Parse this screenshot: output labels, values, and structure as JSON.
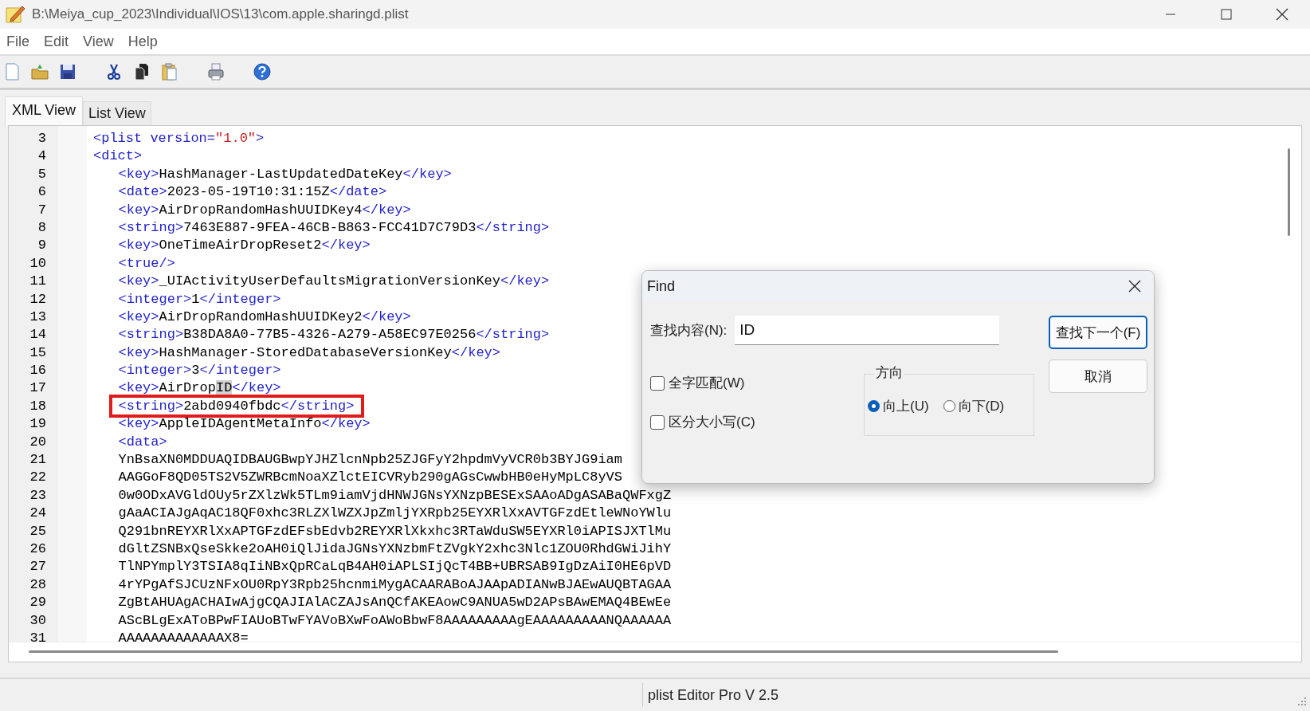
{
  "window": {
    "title": "B:\\Meiya_cup_2023\\Individual\\IOS\\13\\com.apple.sharingd.plist"
  },
  "menu": [
    "File",
    "Edit",
    "View",
    "Help"
  ],
  "toolbar": [
    {
      "kind": "new"
    },
    {
      "kind": "open"
    },
    {
      "kind": "save"
    },
    {
      "kind": "cut"
    },
    {
      "kind": "copy"
    },
    {
      "kind": "paste"
    },
    {
      "kind": "print"
    },
    {
      "kind": "help"
    }
  ],
  "tabs": [
    {
      "label": "XML View",
      "selected": true
    },
    {
      "label": "List View",
      "selected": false
    }
  ],
  "editor": {
    "lines": [
      {
        "number": "3",
        "text": "<plist version=\"1.0\">"
      },
      {
        "number": "4",
        "text": "<dict>",
        "children": [
          {
            "number": "5",
            "text": "<key>HashManager-LastUpdatedDateKey</key>"
          },
          {
            "number": "6",
            "text": "<date>2023-05-19T10:31:15Z</date>"
          },
          {
            "number": "7",
            "text": "<key>AirDropRandomHashUUIDKey4</key>"
          },
          {
            "number": "8",
            "text": "<string>7463E887-9FEA-46CB-B863-FCC41D7C79D3</string>"
          },
          {
            "number": "9",
            "text": "<key>OneTimeAirDropReset2</key>"
          },
          {
            "number": "10",
            "text": "<true/>"
          },
          {
            "number": "11",
            "text": "<key>_UIActivityUserDefaultsMigrationVersionKey</key>"
          },
          {
            "number": "12",
            "text": "<integer>1</integer>"
          },
          {
            "number": "13",
            "text": "<key>AirDropRandomHashUUIDKey2</key>"
          },
          {
            "number": "14",
            "text": "<string>B38DA8A0-77B5-4326-A279-A58EC97E0256</string>"
          },
          {
            "number": "15",
            "text": "<key>HashManager-StoredDatabaseVersionKey</key>"
          },
          {
            "number": "16",
            "text": "<integer>3</integer>"
          },
          {
            "number": "17",
            "text": "<key>AirDrop",
            "selection": "ID",
            "text_after": "</key>"
          },
          {
            "number": "18",
            "text": "<string>2abd0940fbdc</string>",
            "boxed": true
          },
          {
            "number": "19",
            "text": "<key>AppleIDAgentMetaInfo</key>"
          },
          {
            "number": "20",
            "text": "<data>"
          },
          {
            "number": "21",
            "text": "YnBsaXN0MDDUAQIDBAUGBwpYJHZlcnNpb25ZJGFyY2hpdmVyVCR0b3BYJG9iam"
          },
          {
            "number": "22",
            "text": "AAGGoF8QD05TS2V5ZWRBcmNoaXZlctEICVRyb290gAGsCwwbHB0eHyMpLC8yVS"
          },
          {
            "number": "23",
            "text": "0w0ODxAVGldOUy5rZXlzWk5TLm9iamVjdHNWJGNsYXNzpBESExSAAoADgASABaQWFxgZ"
          },
          {
            "number": "24",
            "text": "gAaACIAJgAqAC18QF0xhc3RLZXlWZXJpZmljYXRpb25EYXRlXxAVTGFzdEtleWNoYWlu"
          },
          {
            "number": "25",
            "text": "Q291bnREYXRlXxAPTGFzdEFsbEdvb2REYXRlXkxhc3RTaWduSW5EYXRl0iAPISJXTlMu"
          },
          {
            "number": "26",
            "text": "dGltZSNBxQseSkke2oAH0iQlJidaJGNsYXNzbmFtZVgkY2xhc3Nlc1ZOU0RhdGWiJihY"
          },
          {
            "number": "27",
            "text": "TlNPYmplY3TSIA8qIiNBxQpRCaLqB4AH0iAPLSIjQcT4BB+UBRSAB9IgDzAiI0HE6pVD"
          },
          {
            "number": "28",
            "text": "4rYPgAfSJCUzNFxOU0RpY3Rpb25hcnmiMygACAARABoAJAApADIANwBJAEwAUQBTAGAA"
          },
          {
            "number": "29",
            "text": "ZgBtAHUAgACHAIwAjgCQAJIAlACZAJsAnQCfAKEAowC9ANUA5wD2APsBAwEMAQ4BEwEe"
          },
          {
            "number": "30",
            "text": "AScBLgExAToBPwFIAUoBTwFYAVoBXwFoAWoBbwF8AAAAAAAAAgEAAAAAAAAANQAAAAAA"
          },
          {
            "number": "31",
            "text": "AAAAAAAAAAAAAX8="
          }
        ]
      }
    ]
  },
  "find_dialog": {
    "title": "Find",
    "find_label": "查找内容(N):",
    "find_value": "ID",
    "options": [
      {
        "label": "全字匹配(W)",
        "checked": false
      },
      {
        "label": "区分大小写(C)",
        "checked": false
      }
    ],
    "direction": {
      "label": "方向",
      "options": [
        {
          "label": "向上(U)",
          "selected": true
        },
        {
          "label": "向下(D)",
          "selected": false
        }
      ]
    },
    "buttons": [
      {
        "label": "查找下一个(F)",
        "default": true
      },
      {
        "label": "取消",
        "default": false
      }
    ]
  },
  "status_bar": {
    "text": "plist Editor Pro V 2.5"
  }
}
